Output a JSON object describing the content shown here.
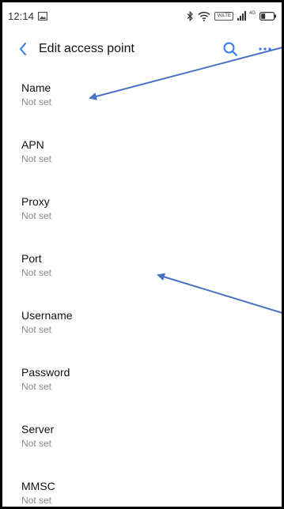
{
  "status_bar": {
    "time": "12:14",
    "network_badge": "VoLTE",
    "signal_badge": "4G",
    "icons": [
      "image-notification-icon",
      "bluetooth-icon",
      "wifi-icon",
      "volte-icon",
      "signal-icon",
      "battery-icon"
    ]
  },
  "app_bar": {
    "title": "Edit access point",
    "back_icon": "chevron-left-icon",
    "actions": [
      "search-icon",
      "more-icon"
    ]
  },
  "fields": [
    {
      "label": "Name",
      "value": "Not set"
    },
    {
      "label": "APN",
      "value": "Not set"
    },
    {
      "label": "Proxy",
      "value": "Not set"
    },
    {
      "label": "Port",
      "value": "Not set"
    },
    {
      "label": "Username",
      "value": "Not set"
    },
    {
      "label": "Password",
      "value": "Not set"
    },
    {
      "label": "Server",
      "value": "Not set"
    },
    {
      "label": "MMSC",
      "value": "Not set"
    }
  ],
  "colors": {
    "accent": "#2f7cf6",
    "annotation_arrow": "#4a72c4",
    "frame": "#000000",
    "secondary_text": "#8a8a8a"
  }
}
